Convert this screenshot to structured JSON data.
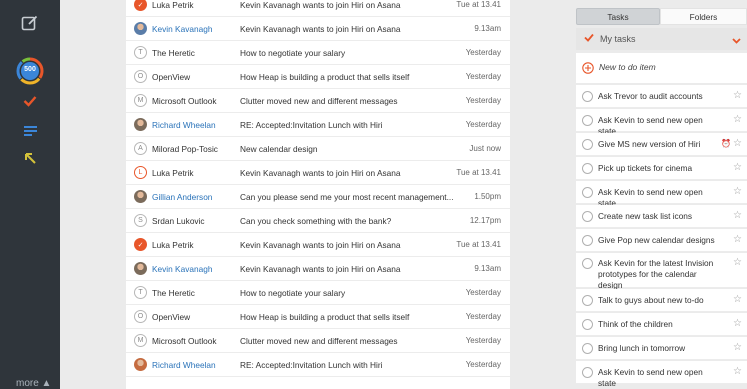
{
  "sidebar": {
    "compose_icon": "compose-icon",
    "counter": "500",
    "more_label": "more ▲"
  },
  "emails": [
    {
      "sender": "Luka Petrik",
      "subject": "Kevin Kavanagh wants to join Hiri on Asana",
      "time": "Tue at 13.41",
      "avatar": "check",
      "avatar_text": "✓"
    },
    {
      "sender": "Kevin Kavanagh",
      "subject": "Kevin Kavanagh wants to join Hiri on Asana",
      "time": "9.13am",
      "avatar": "photo",
      "avatar_text": "",
      "sender_blue": true
    },
    {
      "sender": "The Heretic",
      "subject": "How to negotiate your salary",
      "time": "Yesterday",
      "avatar": "letter",
      "avatar_text": "T"
    },
    {
      "sender": "OpenView",
      "subject": "How Heap is building a product that sells itself",
      "time": "Yesterday",
      "avatar": "letter",
      "avatar_text": "O"
    },
    {
      "sender": "Microsoft Outlook",
      "subject": "Clutter moved new and different messages",
      "time": "Yesterday",
      "avatar": "letter",
      "avatar_text": "M"
    },
    {
      "sender": "Richard Wheelan",
      "subject": "RE: Accepted:Invitation Lunch with Hiri",
      "time": "Yesterday",
      "avatar": "photo",
      "avatar_text": "",
      "sender_blue": true
    },
    {
      "sender": "Milorad Pop-Tosic",
      "subject": "New calendar design",
      "time": "Just now",
      "avatar": "letter",
      "avatar_text": "A"
    },
    {
      "sender": "Luka Petrik",
      "subject": "Kevin Kavanagh wants to join Hiri on Asana",
      "time": "Tue at 13.41",
      "avatar": "ring",
      "avatar_text": "L"
    },
    {
      "sender": "Gillian Anderson",
      "subject": "Can you please send me your most recent management...",
      "time": "1.50pm",
      "avatar": "photo",
      "avatar_text": "",
      "sender_blue": true
    },
    {
      "sender": "Srdan Lukovic",
      "subject": "Can you check something with the bank?",
      "time": "12.17pm",
      "avatar": "letter",
      "avatar_text": "S"
    },
    {
      "sender": "Luka Petrik",
      "subject": "Kevin Kavanagh wants to join Hiri on Asana",
      "time": "Tue at 13.41",
      "avatar": "check",
      "avatar_text": "✓"
    },
    {
      "sender": "Kevin Kavanagh",
      "subject": "Kevin Kavanagh wants to join Hiri on Asana",
      "time": "9.13am",
      "avatar": "photo",
      "avatar_text": "",
      "sender_blue": true
    },
    {
      "sender": "The Heretic",
      "subject": "How to negotiate your salary",
      "time": "Yesterday",
      "avatar": "letter",
      "avatar_text": "T"
    },
    {
      "sender": "OpenView",
      "subject": "How Heap is building a product that sells itself",
      "time": "Yesterday",
      "avatar": "letter",
      "avatar_text": "O"
    },
    {
      "sender": "Microsoft Outlook",
      "subject": "Clutter moved new and different messages",
      "time": "Yesterday",
      "avatar": "letter",
      "avatar_text": "M"
    },
    {
      "sender": "Richard Wheelan",
      "subject": "RE: Accepted:Invitation Lunch with Hiri",
      "time": "Yesterday",
      "avatar": "photo",
      "avatar_text": "",
      "sender_blue": true
    }
  ],
  "tasks_panel": {
    "tab_tasks": "Tasks",
    "tab_folders": "Folders",
    "section_title": "My tasks",
    "new_item": "New to do item",
    "items": [
      {
        "text": "Ask Trevor to audit accounts"
      },
      {
        "text": "Ask Kevin to send new open state"
      },
      {
        "text": "Give MS new version of Hiri",
        "has_reminder": true
      },
      {
        "text": "Pick up tickets for cinema"
      },
      {
        "text": "Ask Kevin to send new open state"
      },
      {
        "text": "Create new task list icons"
      },
      {
        "text": "Give Pop new calendar designs"
      },
      {
        "text": "Ask Kevin for the latest Invision prototypes for the calendar design"
      },
      {
        "text": "Talk to guys about new to-do"
      },
      {
        "text": "Think of the children"
      },
      {
        "text": "Bring lunch in tomorrow"
      },
      {
        "text": "Ask Kevin to send new open state"
      }
    ]
  },
  "colors": {
    "accent": "#e8562a",
    "link_blue": "#2a73b9",
    "sidebar_bg": "#2f353b"
  }
}
